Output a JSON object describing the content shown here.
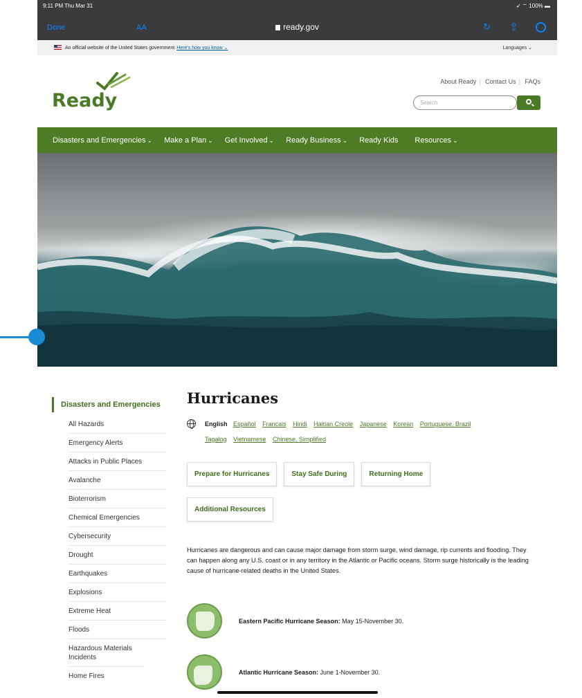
{
  "status": {
    "time": "9:11 PM  Thu Mar 31",
    "battery": "100%"
  },
  "browser": {
    "done": "Done",
    "text_size": "AA",
    "url": "ready.gov"
  },
  "gov_banner": {
    "text": "An official website of the United States government",
    "link": "Here's how you know ⌄",
    "languages": "Languages  ⌄"
  },
  "header": {
    "logo": "Ready",
    "links": [
      "About Ready",
      "Contact Us",
      "FAQs"
    ],
    "search_placeholder": "Search"
  },
  "nav": [
    {
      "label": "Disasters and Emergencies",
      "chevron": true
    },
    {
      "label": "Make a Plan",
      "chevron": true
    },
    {
      "label": "Get Involved",
      "chevron": true
    },
    {
      "label": "Ready Business",
      "chevron": true
    },
    {
      "label": "Ready Kids",
      "chevron": false
    },
    {
      "label": "Resources",
      "chevron": true
    }
  ],
  "sidebar": {
    "heading": "Disasters and Emergencies",
    "items": [
      "All Hazards",
      "Emergency Alerts",
      "Attacks in Public Places",
      "Avalanche",
      "Bioterrorism",
      "Chemical Emergencies",
      "Cybersecurity",
      "Drought",
      "Earthquakes",
      "Explosions",
      "Extreme Heat",
      "Floods",
      "Hazardous Materials Incidents",
      "Home Fires"
    ]
  },
  "main": {
    "title": "Hurricanes",
    "current_language": "English",
    "languages": [
      "Español",
      "Francais",
      "Hindi",
      "Haitian Creole",
      "Japanese",
      "Korean",
      "Portuguese, Brazil",
      "Tagalog",
      "Vietnamese",
      "Chinese, Simplified"
    ],
    "tabs": [
      "Prepare for Hurricanes",
      "Stay Safe During",
      "Returning Home",
      "Additional Resources"
    ],
    "intro": "Hurricanes are dangerous and can cause major damage from storm surge, wind damage, rip currents and flooding. They can happen along any U.S. coast or in any territory in the Atlantic or Pacific oceans. Storm surge historically is the leading cause of hurricane-related deaths in the United States.",
    "seasons": [
      {
        "label": "Eastern Pacific Hurricane Season:",
        "dates": "May 15-November 30."
      },
      {
        "label": "Atlantic Hurricane Season:",
        "dates": "June 1-November 30."
      }
    ]
  }
}
